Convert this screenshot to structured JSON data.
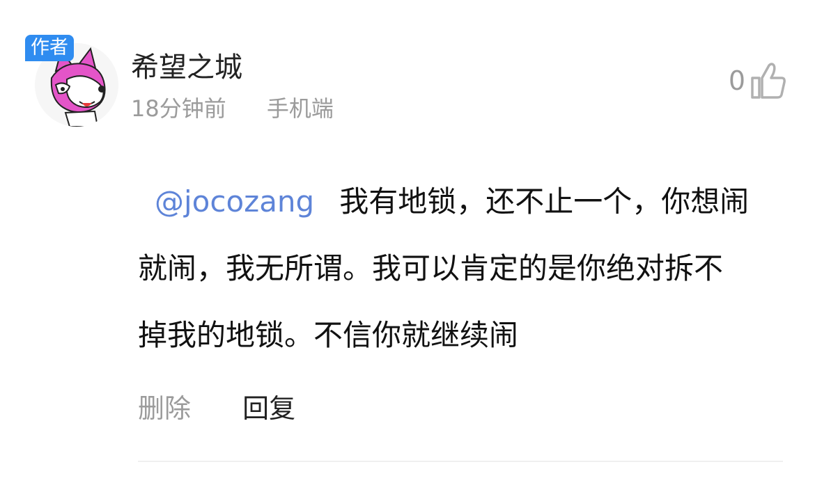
{
  "comment": {
    "author_badge": "作者",
    "username": "希望之城",
    "time": "18分钟前",
    "device": "手机端",
    "like_count": "0",
    "mention": "@jocozang",
    "text": "我有地锁，还不止一个，你想闹就闹，我无所谓。我可以肯定的是你绝对拆不掉我的地锁。不信你就继续闹"
  },
  "actions": {
    "delete_label": "删除",
    "reply_label": "回复"
  },
  "icons": {
    "like": "thumbs-up-icon",
    "avatar": "cartoon-fox-avatar"
  },
  "colors": {
    "badge": "#2f8cf0",
    "mention": "#5e84d8",
    "muted": "#9b9b9b",
    "text": "#111111"
  }
}
